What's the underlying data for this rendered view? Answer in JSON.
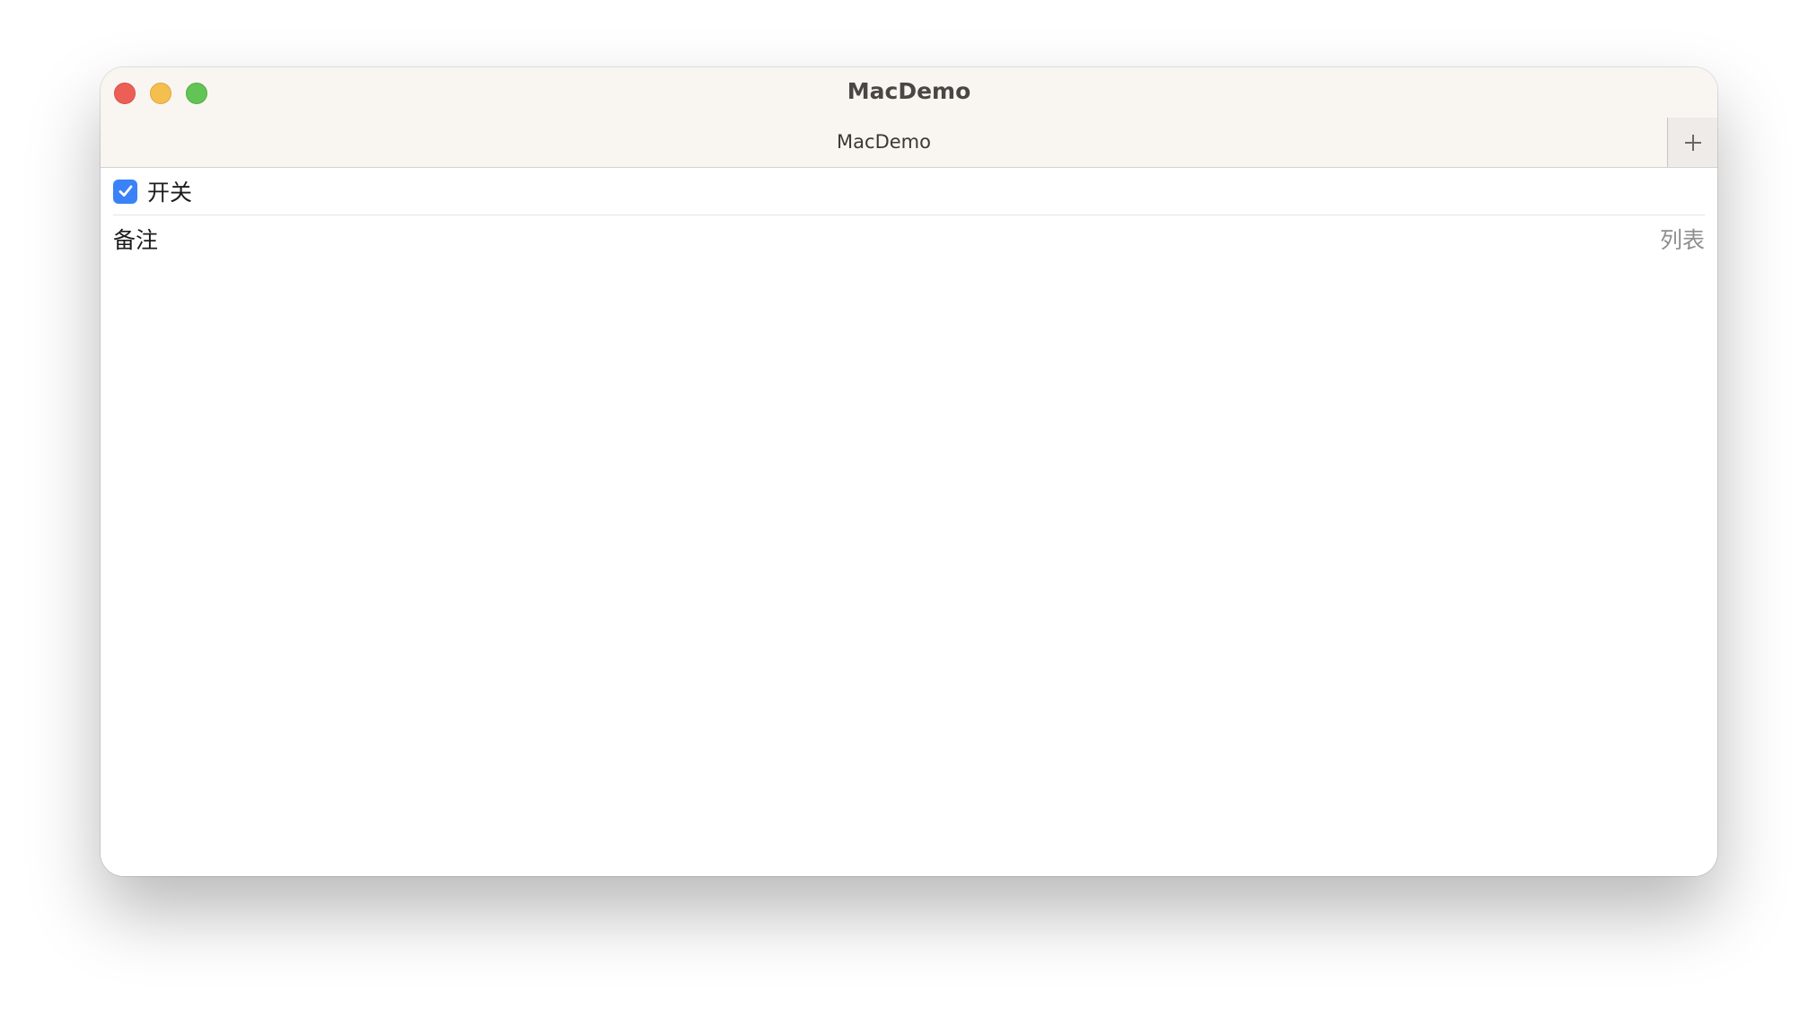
{
  "window": {
    "title": "MacDemo"
  },
  "tabs": [
    {
      "label": "MacDemo",
      "active": true
    }
  ],
  "form": {
    "toggle": {
      "label": "开关",
      "checked": true
    },
    "note": {
      "label": "备注",
      "placeholder": "列表"
    }
  },
  "icons": {
    "new_tab": "plus-icon",
    "checkmark": "checkmark-icon"
  },
  "colors": {
    "accent": "#3a82f7",
    "close": "#ec5f57",
    "minimize": "#f4bf4f",
    "zoom": "#61c454"
  }
}
